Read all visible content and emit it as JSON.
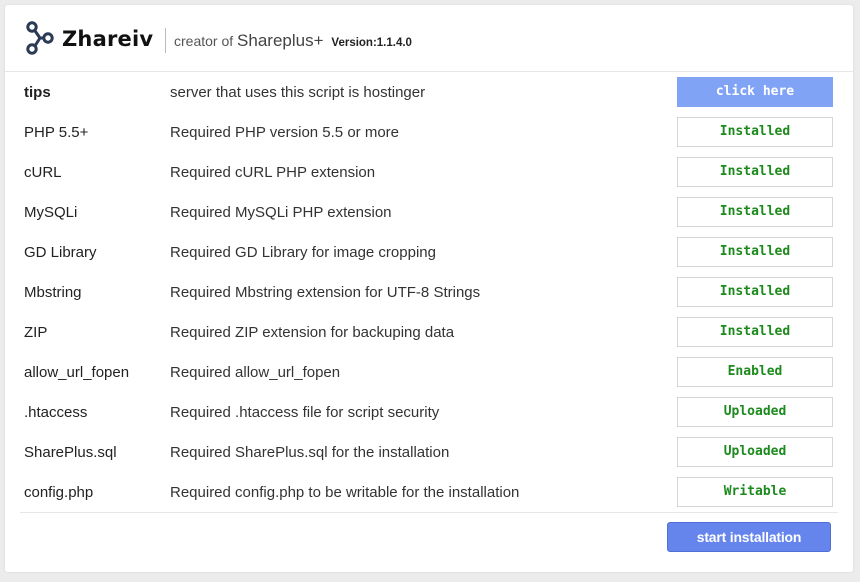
{
  "header": {
    "brand": "Zhareiv",
    "creator_prefix": "creator of",
    "product": "Shareplus+",
    "version": "Version:1.1.4.0",
    "logo_icon": "share-nodes-icon",
    "logo_color": "#2b3a55"
  },
  "requirements": [
    {
      "name": "tips",
      "description": "server that uses this script is hostinger",
      "status": "click here"
    },
    {
      "name": "PHP 5.5+",
      "description": "Required PHP version 5.5 or more",
      "status": "Installed"
    },
    {
      "name": "cURL",
      "description": "Required cURL PHP extension",
      "status": "Installed"
    },
    {
      "name": "MySQLi",
      "description": "Required MySQLi PHP extension",
      "status": "Installed"
    },
    {
      "name": "GD Library",
      "description": "Required GD Library for image cropping",
      "status": "Installed"
    },
    {
      "name": "Mbstring",
      "description": "Required Mbstring extension for UTF-8 Strings",
      "status": "Installed"
    },
    {
      "name": "ZIP",
      "description": "Required ZIP extension for backuping data",
      "status": "Installed"
    },
    {
      "name": "allow_url_fopen",
      "description": "Required allow_url_fopen",
      "status": "Enabled"
    },
    {
      "name": ".htaccess",
      "description": "Required .htaccess file for script security",
      "status": "Uploaded"
    },
    {
      "name": "SharePlus.sql",
      "description": "Required SharePlus.sql for the installation",
      "status": "Uploaded"
    },
    {
      "name": "config.php",
      "description": "Required config.php to be writable for the installation",
      "status": "Writable"
    }
  ],
  "footer": {
    "start_label": "start installation"
  },
  "colors": {
    "status_ok": "#1c8a1c",
    "action_button": "#80a3f6",
    "start_button": "#6585ec"
  }
}
